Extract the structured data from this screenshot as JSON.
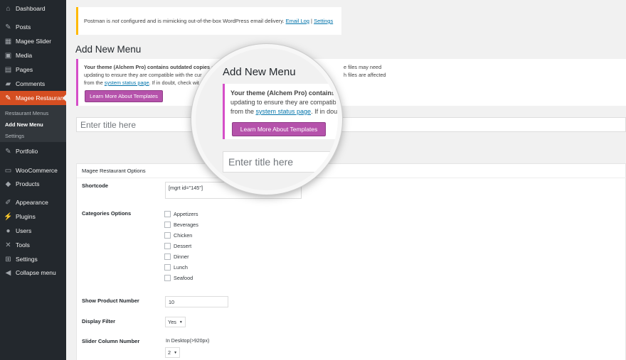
{
  "sidebar": {
    "items": [
      {
        "label": "Dashboard",
        "icon": "dashboard-icon",
        "glyph": "⌂"
      },
      {
        "label": "Posts",
        "icon": "pin-icon",
        "glyph": "✎"
      },
      {
        "label": "Magee Slider",
        "icon": "slider-icon",
        "glyph": "▦"
      },
      {
        "label": "Media",
        "icon": "media-icon",
        "glyph": "▣"
      },
      {
        "label": "Pages",
        "icon": "pages-icon",
        "glyph": "▤"
      },
      {
        "label": "Comments",
        "icon": "comment-icon",
        "glyph": "▰"
      },
      {
        "label": "Magee Restaurant",
        "icon": "pin-icon",
        "glyph": "✎"
      },
      {
        "label": "Portfolio",
        "icon": "pin-icon",
        "glyph": "✎"
      },
      {
        "label": "WooCommerce",
        "icon": "woo-icon",
        "glyph": "▭"
      },
      {
        "label": "Products",
        "icon": "box-icon",
        "glyph": "◆"
      },
      {
        "label": "Appearance",
        "icon": "brush-icon",
        "glyph": "✐"
      },
      {
        "label": "Plugins",
        "icon": "plug-icon",
        "glyph": "⚡"
      },
      {
        "label": "Users",
        "icon": "user-icon",
        "glyph": "●"
      },
      {
        "label": "Tools",
        "icon": "wrench-icon",
        "glyph": "✕"
      },
      {
        "label": "Settings",
        "icon": "settings-icon",
        "glyph": "⊞"
      },
      {
        "label": "Collapse menu",
        "icon": "collapse-icon",
        "glyph": "◀"
      }
    ],
    "submenu": [
      "Restaurant Menus",
      "Add New Menu",
      "Settings"
    ]
  },
  "notice": {
    "prefix": "Postman is ",
    "emphasis": "not",
    "suffix": " configured and is mimicking out-of-the-box WordPress email delivery. ",
    "link1": "Email Log",
    "sep": " | ",
    "link2": "Settings"
  },
  "page_title": "Add New Menu",
  "warning": {
    "line1_bold": "Your theme (Alchem Pro) contains outdated copies of",
    "line2": "updating to ensure they are compatible with the cur",
    "line3_prefix": "from the ",
    "line3_link": "system status page",
    "line3_suffix": ". If in doubt, check wit",
    "right1": "e files may need",
    "right2": "h files are affected",
    "button": "Learn More About Templates"
  },
  "title_placeholder": "Enter title here",
  "options": {
    "header": "Magee Restaurant Options",
    "shortcode_label": "Shortcode",
    "shortcode_value": "[mgrt id=\"145\"]",
    "categories_label": "Categories Options",
    "categories": [
      "Appetizers",
      "Beverages",
      "Chicken",
      "Dessert",
      "Dinner",
      "Lunch",
      "Seafood"
    ],
    "product_number_label": "Show Product Number",
    "product_number_value": "10",
    "display_filter_label": "Display Filter",
    "display_filter_value": "Yes",
    "slider_column_label": "Slider Column Number",
    "desktop_label": "In Desktop(>920px)",
    "desktop_value": "2"
  },
  "magnifier": {
    "title": "Add New Menu",
    "line1_bold": "Your theme (Alchem Pro) contains",
    "line2": "updating to ensure they are compatib",
    "line3_prefix": "from the ",
    "line3_link": "system status page",
    "line3_suffix": ". If in doub",
    "button": "Learn More About Templates",
    "placeholder": "Enter title here"
  }
}
